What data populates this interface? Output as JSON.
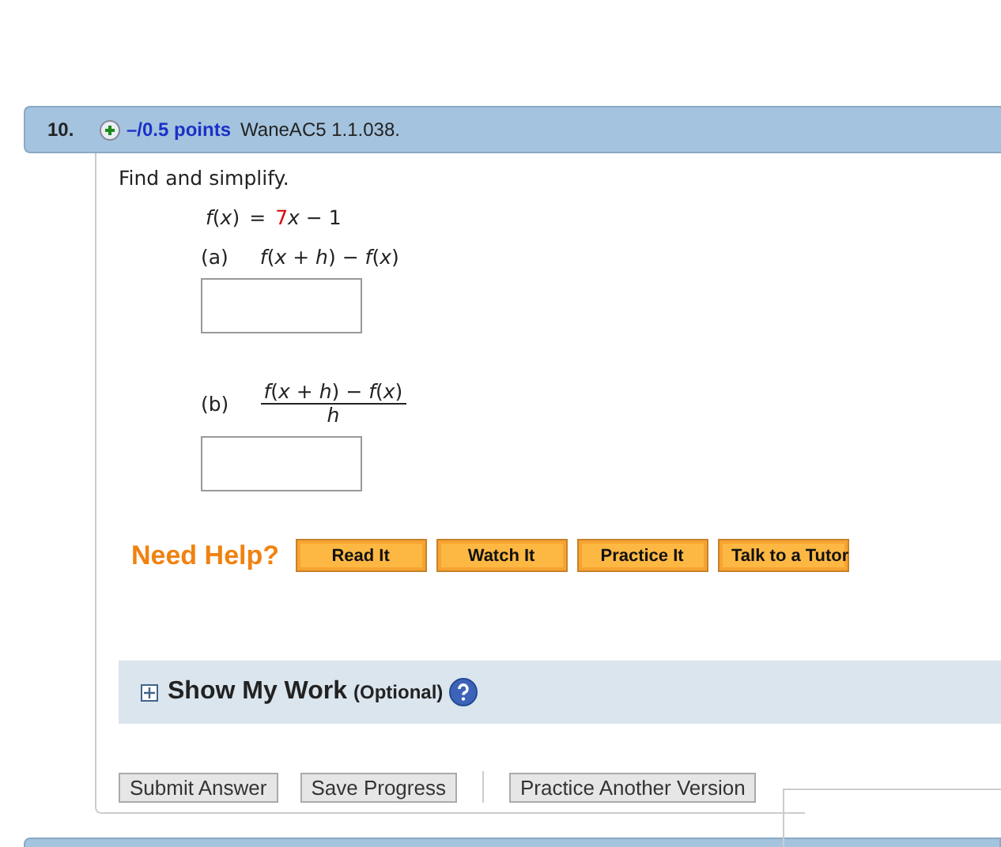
{
  "question": {
    "number": "10.",
    "points": "–/0.5 points",
    "source": "WaneAC5 1.1.038.",
    "expanded": false
  },
  "prompt": "Find and simplify.",
  "function": {
    "lhs": "*f*(*x*)",
    "equals": "=",
    "coefficient": "7",
    "rest": "*x* − 1"
  },
  "parts": [
    {
      "kind": "inline",
      "label": "(a)",
      "expression": "*f*(*x* + *h*) − *f*(*x*)"
    },
    {
      "kind": "fraction",
      "label": "(b)",
      "numerator": "*f*(*x* + *h*) − *f*(*x*)",
      "denominator": "*h*"
    }
  ],
  "help": {
    "title": "Need Help?",
    "buttons": [
      "Read It",
      "Watch It",
      "Practice It",
      "Talk to a Tutor"
    ]
  },
  "work": {
    "title": "Show My Work",
    "note": "(Optional)",
    "expanded": false
  },
  "actions": {
    "left": [
      "Submit Answer",
      "Save Progress"
    ],
    "right": [
      "Practice Another Version"
    ]
  }
}
